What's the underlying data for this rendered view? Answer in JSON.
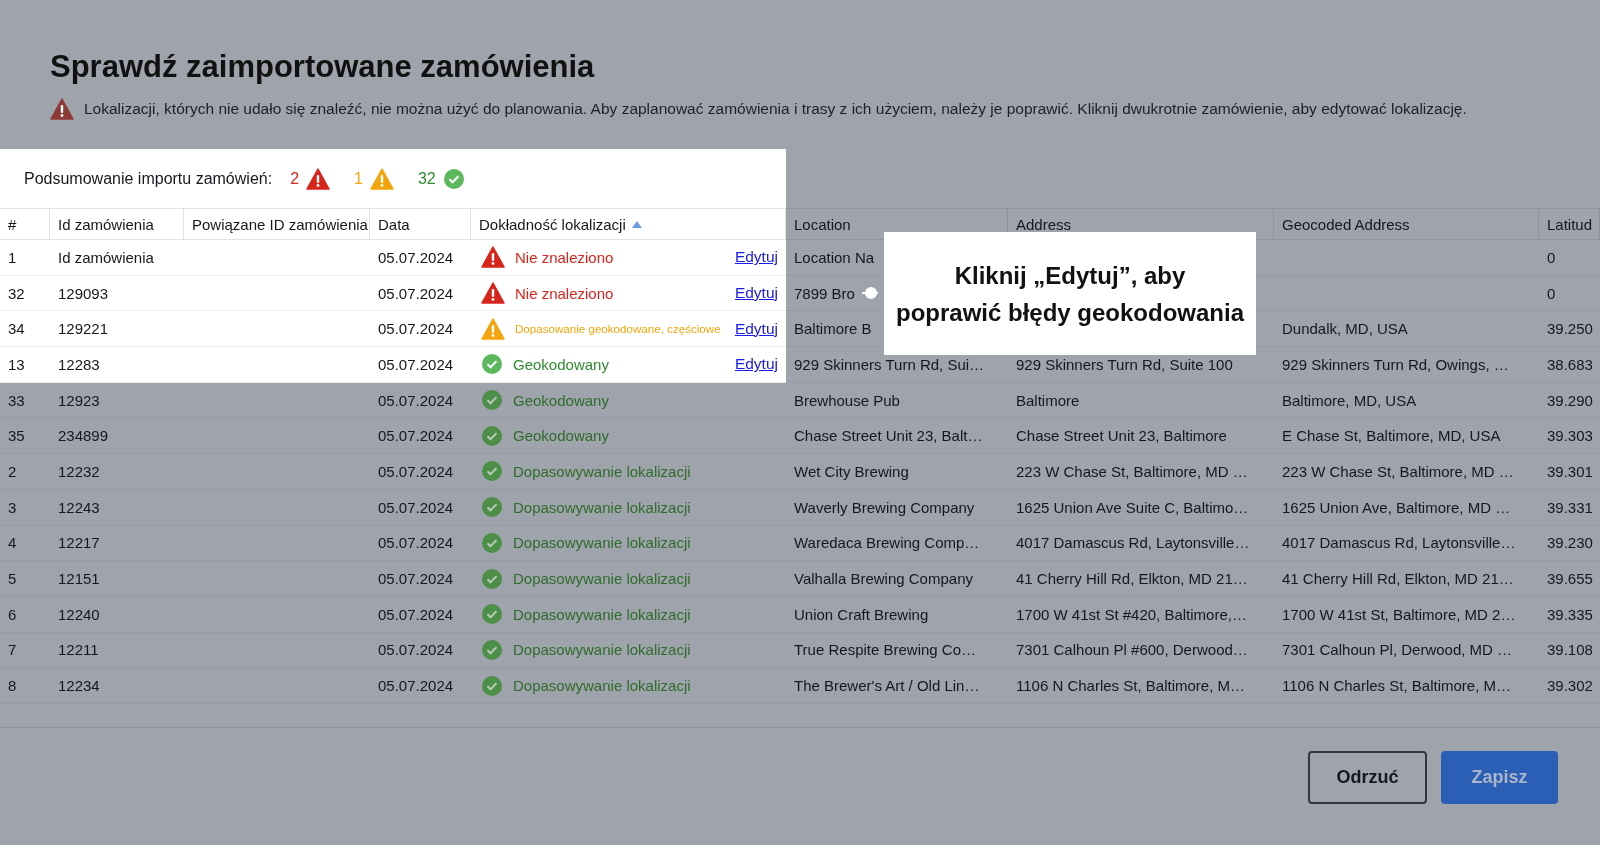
{
  "title": "Sprawdź zaimportowane zamówienia",
  "warning": "Lokalizacji, których nie udało się znaleźć, nie można użyć do planowania. Aby zaplanować zamówienia i trasy z ich użyciem, należy je poprawić. Kliknij dwukrotnie zamówienie, aby edytować lokalizację.",
  "summary": {
    "label": "Podsumowanie importu zamówień:",
    "counts": [
      {
        "kind": "error",
        "count": "2"
      },
      {
        "kind": "warning",
        "count": "1"
      },
      {
        "kind": "success",
        "count": "32"
      }
    ]
  },
  "table": {
    "columns": [
      {
        "label": "#",
        "highlighted": true
      },
      {
        "label": "Id zamówienia",
        "highlighted": true
      },
      {
        "label": "Powiązane ID zamówienia",
        "highlighted": true
      },
      {
        "label": "Data",
        "highlighted": true
      },
      {
        "label": "Dokładność lokalizacji",
        "highlighted": true,
        "sorted_ascending": true
      },
      {
        "label": "Location",
        "highlighted": false
      },
      {
        "label": "Address",
        "highlighted": false
      },
      {
        "label": "Geocoded Address",
        "highlighted": false
      },
      {
        "label": "Latitud",
        "highlighted": false
      }
    ],
    "rows": [
      {
        "highlighted": true,
        "number": "1",
        "order_id": "Id zamówienia",
        "date": "05.07.2024",
        "accuracy": {
          "kind": "error",
          "label": "Nie znaleziono"
        },
        "edit_link": "Edytuj",
        "location": "Location Na",
        "latitude": "0"
      },
      {
        "highlighted": true,
        "number": "32",
        "order_id": "129093",
        "date": "05.07.2024",
        "accuracy": {
          "kind": "error",
          "label": "Nie znaleziono"
        },
        "edit_link": "Edytuj",
        "location": "7899 Bro",
        "latitude": "0"
      },
      {
        "highlighted": true,
        "number": "34",
        "order_id": "129221",
        "date": "05.07.2024",
        "accuracy": {
          "kind": "warning",
          "label": "Dopasowanie geokodowane, częściowe"
        },
        "edit_link": "Edytuj",
        "location": "Baltimore B",
        "geocoded_address": "Dundalk, MD, USA",
        "latitude": "39.250"
      },
      {
        "highlighted": true,
        "number": "13",
        "order_id": "12283",
        "date": "05.07.2024",
        "accuracy": {
          "kind": "success",
          "label": "Geokodowany"
        },
        "edit_link": "Edytuj",
        "location": "929 Skinners Turn Rd, Sui…",
        "address": "929 Skinners Turn Rd, Suite 100",
        "geocoded_address": "929 Skinners Turn Rd, Owings, …",
        "latitude": "38.683"
      },
      {
        "highlighted": false,
        "number": "33",
        "order_id": "12923",
        "date": "05.07.2024",
        "accuracy": {
          "kind": "success",
          "label": "Geokodowany"
        },
        "location": "Brewhouse Pub",
        "address": "Baltimore",
        "geocoded_address": "Baltimore, MD, USA",
        "latitude": "39.290"
      },
      {
        "highlighted": false,
        "number": "35",
        "order_id": "234899",
        "date": "05.07.2024",
        "accuracy": {
          "kind": "success",
          "label": "Geokodowany"
        },
        "location": "Chase Street Unit 23, Balt…",
        "address": "Chase Street Unit 23, Baltimore",
        "geocoded_address": "E Chase St, Baltimore, MD, USA",
        "latitude": "39.303"
      },
      {
        "highlighted": false,
        "number": "2",
        "order_id": "12232",
        "date": "05.07.2024",
        "accuracy": {
          "kind": "success",
          "label": "Dopasowywanie lokalizacji"
        },
        "location": "Wet City Brewing",
        "address": "223 W Chase St, Baltimore, MD …",
        "geocoded_address": "223 W Chase St, Baltimore, MD …",
        "latitude": "39.301"
      },
      {
        "highlighted": false,
        "number": "3",
        "order_id": "12243",
        "date": "05.07.2024",
        "accuracy": {
          "kind": "success",
          "label": "Dopasowywanie lokalizacji"
        },
        "location": "Waverly Brewing Company",
        "address": "1625 Union Ave Suite C, Baltimo…",
        "geocoded_address": "1625 Union Ave, Baltimore, MD …",
        "latitude": "39.331"
      },
      {
        "highlighted": false,
        "number": "4",
        "order_id": "12217",
        "date": "05.07.2024",
        "accuracy": {
          "kind": "success",
          "label": "Dopasowywanie lokalizacji"
        },
        "location": "Waredaca Brewing Comp…",
        "address": "4017 Damascus Rd, Laytonsville…",
        "geocoded_address": "4017 Damascus Rd, Laytonsville…",
        "latitude": "39.230"
      },
      {
        "highlighted": false,
        "number": "5",
        "order_id": "12151",
        "date": "05.07.2024",
        "accuracy": {
          "kind": "success",
          "label": "Dopasowywanie lokalizacji"
        },
        "location": "Valhalla Brewing Company",
        "address": "41 Cherry Hill Rd, Elkton, MD 21…",
        "geocoded_address": "41 Cherry Hill Rd, Elkton, MD 21…",
        "latitude": "39.655"
      },
      {
        "highlighted": false,
        "number": "6",
        "order_id": "12240",
        "date": "05.07.2024",
        "accuracy": {
          "kind": "success",
          "label": "Dopasowywanie lokalizacji"
        },
        "location": "Union Craft Brewing",
        "address": "1700 W 41st St #420, Baltimore,…",
        "geocoded_address": "1700 W 41st St, Baltimore, MD 2…",
        "latitude": "39.335"
      },
      {
        "highlighted": false,
        "number": "7",
        "order_id": "12211",
        "date": "05.07.2024",
        "accuracy": {
          "kind": "success",
          "label": "Dopasowywanie lokalizacji"
        },
        "location": "True Respite Brewing Co…",
        "address": "7301 Calhoun Pl #600, Derwood…",
        "geocoded_address": "7301 Calhoun Pl, Derwood, MD …",
        "latitude": "39.108"
      },
      {
        "highlighted": false,
        "number": "8",
        "order_id": "12234",
        "date": "05.07.2024",
        "accuracy": {
          "kind": "success",
          "label": "Dopasowywanie lokalizacji"
        },
        "location": "The Brewer's Art / Old Lin…",
        "address": "1106 N Charles St, Baltimore, M…",
        "geocoded_address": "1106 N Charles St, Baltimore, M…",
        "latitude": "39.302"
      }
    ]
  },
  "callout": {
    "text": "Kliknij „Edytuj”, aby\npoprawić błędy geokodowania"
  },
  "buttons": [
    {
      "kind": "secondary",
      "label": "Odrzuć"
    },
    {
      "kind": "primary",
      "label": "Zapisz"
    }
  ]
}
